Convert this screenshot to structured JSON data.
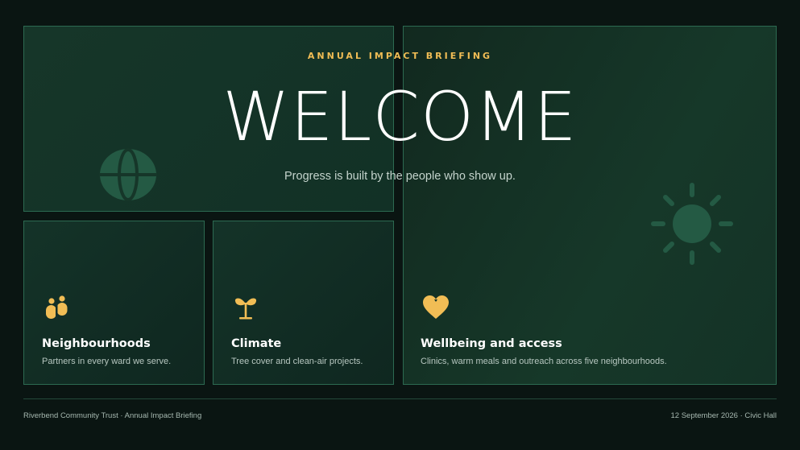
{
  "hero": {
    "eyebrow": "ANNUAL IMPACT BRIEFING",
    "headline": "WELCOME",
    "tagline": "Progress is built by the people who show up."
  },
  "cards": [
    {
      "title": "Neighbourhoods",
      "description": "Partners in every ward we serve.",
      "icon": "people-icon"
    },
    {
      "title": "Climate",
      "description": "Tree cover and clean-air projects.",
      "icon": "sprout-icon"
    },
    {
      "title": "Wellbeing and access",
      "description": "Clinics, warm meals and outreach across five neighbourhoods.",
      "icon": "heart-icon"
    }
  ],
  "footer": {
    "left": "Riverbend Community Trust · Annual Impact Briefing",
    "right": "12 September 2026 · Civic Hall"
  },
  "decor": {
    "globe": "globe-icon",
    "sun": "sun-icon"
  },
  "colors": {
    "background": "#0a1512",
    "panel": "#143328",
    "border": "#2c6a51",
    "accent": "#f1bd55",
    "decor": "#245a44",
    "text": "#ffffff",
    "muted": "#b7c7c0"
  }
}
